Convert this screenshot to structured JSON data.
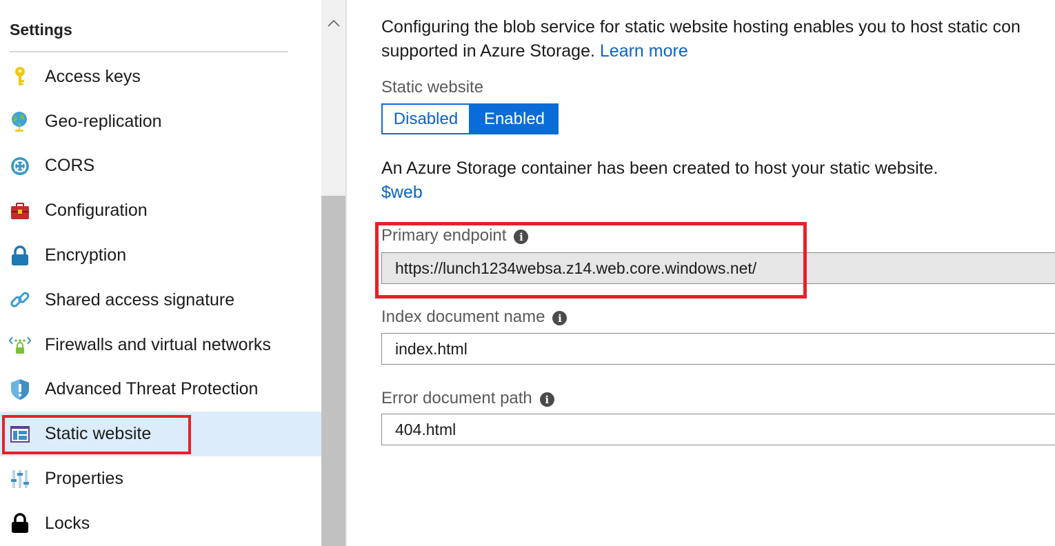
{
  "sidebar": {
    "heading": "Settings",
    "items": [
      {
        "label": "Access keys",
        "icon": "key-icon"
      },
      {
        "label": "Geo-replication",
        "icon": "globe-icon"
      },
      {
        "label": "CORS",
        "icon": "cors-icon"
      },
      {
        "label": "Configuration",
        "icon": "toolbox-icon"
      },
      {
        "label": "Encryption",
        "icon": "lock-icon"
      },
      {
        "label": "Shared access signature",
        "icon": "link-icon"
      },
      {
        "label": "Firewalls and virtual networks",
        "icon": "firewall-network-icon"
      },
      {
        "label": "Advanced Threat Protection",
        "icon": "shield-icon"
      },
      {
        "label": "Static website",
        "icon": "static-website-icon",
        "selected": true
      },
      {
        "label": "Properties",
        "icon": "properties-icon"
      },
      {
        "label": "Locks",
        "icon": "padlock-icon"
      }
    ]
  },
  "main": {
    "intro_line1": "Configuring the blob service for static website hosting enables you to host static con",
    "intro_line2": "supported in Azure Storage.",
    "learn_more": "Learn more",
    "static_website": {
      "label": "Static website",
      "options": [
        "Disabled",
        "Enabled"
      ],
      "selected": "Enabled"
    },
    "container_text": "An Azure Storage container has been created to host your static website.",
    "container_link": "$web",
    "primary_endpoint": {
      "label": "Primary endpoint",
      "value": "https://lunch1234websa.z14.web.core.windows.net/"
    },
    "index_document": {
      "label": "Index document name",
      "value": "index.html"
    },
    "error_document": {
      "label": "Error document path",
      "value": "404.html"
    }
  },
  "colors": {
    "accent": "#0a6cd8",
    "link": "#0a64c8",
    "highlight": "#e8202a",
    "selected_bg": "#dcecfb"
  }
}
